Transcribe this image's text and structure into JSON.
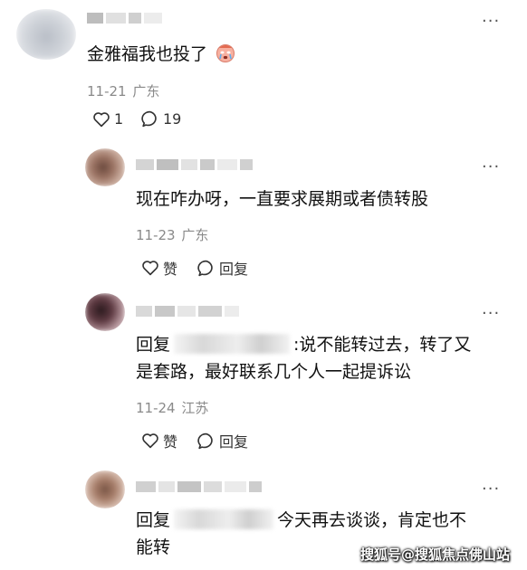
{
  "main_comment": {
    "text": "金雅福我也投了",
    "date": "11-21",
    "location": "广东",
    "likes": "1",
    "replies_count": "19"
  },
  "replies": [
    {
      "text": "现在咋办呀，一直要求展期或者债转股",
      "date": "11-23",
      "location": "广东",
      "like_label": "赞",
      "reply_label": "回复"
    },
    {
      "reply_prefix": "回复",
      "text_line1": ":说不能转过去，转了又",
      "text_line2": "是套路，最好联系几个人一起提诉讼",
      "date": "11-24",
      "location": "江苏",
      "like_label": "赞",
      "reply_label": "回复"
    },
    {
      "reply_prefix": "回复",
      "text_line1": "今天再去谈谈，肯定也不",
      "text_line2": "能转"
    }
  ],
  "more_label": "···",
  "watermark": "搜狐号@搜狐焦点佛山站"
}
